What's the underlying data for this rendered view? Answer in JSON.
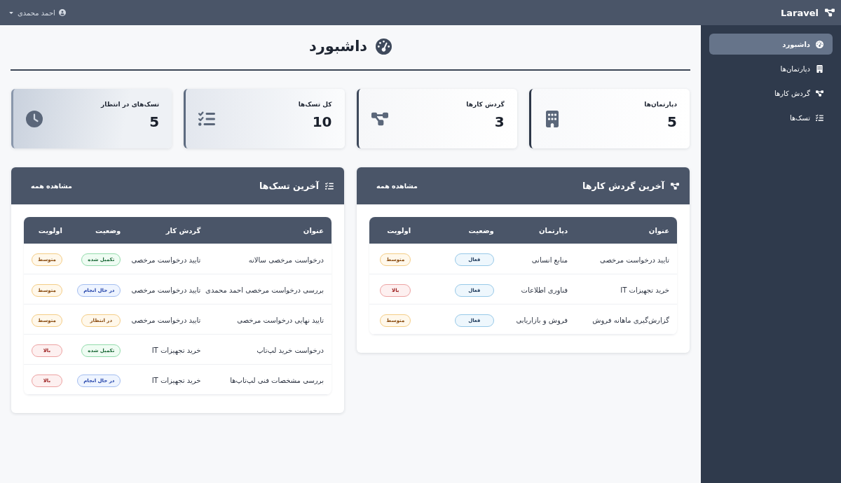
{
  "top_bar": {
    "brand": "Laravel",
    "user": "احمد محمدی"
  },
  "sidebar": {
    "items": [
      {
        "label": "داشبورد",
        "selected": true
      },
      {
        "label": "دپارتمان‌ها",
        "selected": false
      },
      {
        "label": "گردش کارها",
        "selected": false
      },
      {
        "label": "تسک‌ها",
        "selected": false
      }
    ]
  },
  "page_title": "داشبورد",
  "stats": [
    {
      "label": "دپارتمان‌ها",
      "value": "5"
    },
    {
      "label": "گردش کارها",
      "value": "3"
    },
    {
      "label": "کل تسک‌ها",
      "value": "10"
    },
    {
      "label": "تسک‌های در انتظار",
      "value": "5"
    }
  ],
  "panels": [
    {
      "title": "آخرین گردش کارها",
      "link": "مشاهده همه",
      "table": {
        "columns": [
          "عنوان",
          "دپارتمان",
          "وضعیت",
          "اولویت"
        ],
        "rows": [
          {
            "cells": [
              "تایید درخواست مرخصی",
              "منابع انسانی"
            ],
            "status": {
              "label": "فعال",
              "kind": "active"
            },
            "priority": {
              "label": "متوسط",
              "kind": "medium"
            }
          },
          {
            "cells": [
              "خرید تجهیزات IT",
              "فناوری اطلاعات"
            ],
            "status": {
              "label": "فعال",
              "kind": "active"
            },
            "priority": {
              "label": "بالا",
              "kind": "high"
            }
          },
          {
            "cells": [
              "گزارش‌گیری ماهانه فروش",
              "فروش و بازاریابی"
            ],
            "status": {
              "label": "فعال",
              "kind": "active"
            },
            "priority": {
              "label": "متوسط",
              "kind": "medium"
            }
          }
        ]
      }
    },
    {
      "title": "آخرین تسک‌ها",
      "link": "مشاهده همه",
      "table": {
        "columns": [
          "عنوان",
          "گردش کار",
          "وضعیت",
          "اولویت"
        ],
        "rows": [
          {
            "cells": [
              "درخواست مرخصی سالانه",
              "تایید درخواست مرخصی"
            ],
            "status": {
              "label": "تکمیل شده",
              "kind": "done"
            },
            "priority": {
              "label": "متوسط",
              "kind": "medium"
            }
          },
          {
            "cells": [
              "بررسی درخواست مرخصی احمد محمدی",
              "تایید درخواست مرخصی"
            ],
            "status": {
              "label": "در حال انجام",
              "kind": "progress"
            },
            "priority": {
              "label": "متوسط",
              "kind": "medium"
            }
          },
          {
            "cells": [
              "تایید نهایی درخواست مرخصی",
              "تایید درخواست مرخصی"
            ],
            "status": {
              "label": "در انتظار",
              "kind": "pending"
            },
            "priority": {
              "label": "متوسط",
              "kind": "medium"
            }
          },
          {
            "cells": [
              "درخواست خرید لپ‌تاپ",
              "خرید تجهیزات IT"
            ],
            "status": {
              "label": "تکمیل شده",
              "kind": "done"
            },
            "priority": {
              "label": "بالا",
              "kind": "high"
            }
          },
          {
            "cells": [
              "بررسی مشخصات فنی لپ‌تاپ‌ها",
              "خرید تجهیزات IT"
            ],
            "status": {
              "label": "در حال انجام",
              "kind": "progress"
            },
            "priority": {
              "label": "بالا",
              "kind": "high"
            }
          }
        ]
      }
    }
  ]
}
